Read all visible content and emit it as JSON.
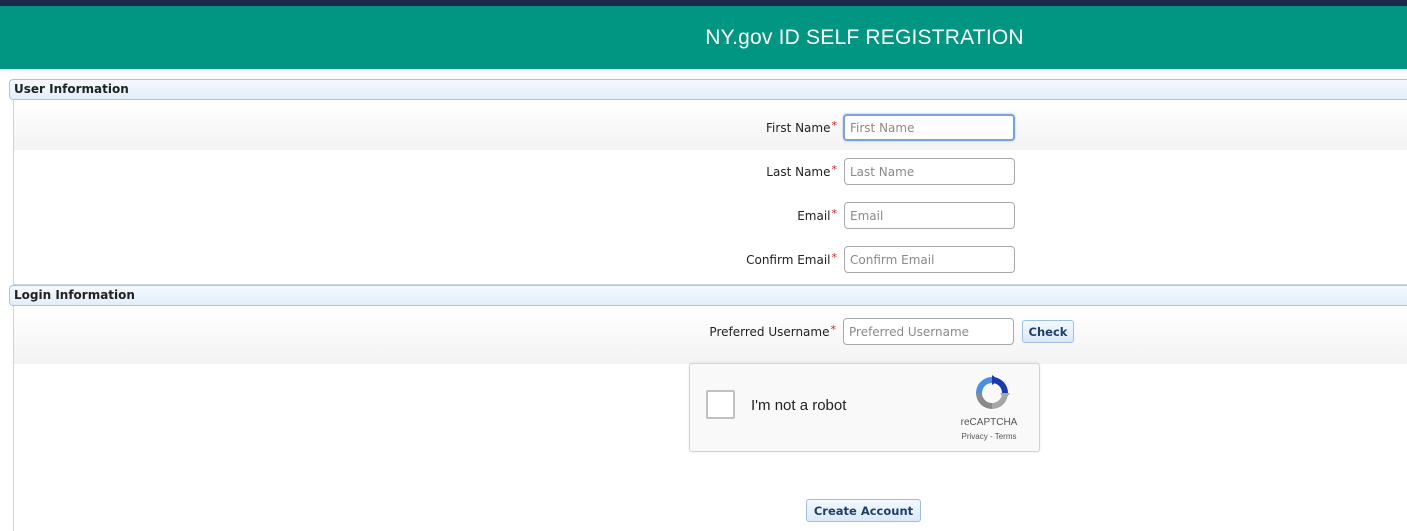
{
  "banner": {
    "title": "NY.gov ID SELF REGISTRATION"
  },
  "user_info": {
    "header": "User Information",
    "fields": [
      {
        "label": "First Name",
        "required_mark": "*",
        "placeholder": "First Name",
        "value": ""
      },
      {
        "label": "Last Name",
        "required_mark": "*",
        "placeholder": "Last Name",
        "value": ""
      },
      {
        "label": "Email",
        "required_mark": "*",
        "placeholder": "Email",
        "value": ""
      },
      {
        "label": "Confirm Email",
        "required_mark": "*",
        "placeholder": "Confirm Email",
        "value": ""
      }
    ]
  },
  "login_info": {
    "header": "Login Information",
    "username": {
      "label": "Preferred Username",
      "required_mark": "*",
      "placeholder": "Preferred Username",
      "value": ""
    },
    "check_button": "Check",
    "create_button": "Create Account"
  },
  "captcha": {
    "label": "I'm not a robot",
    "brand": "reCAPTCHA",
    "links": "Privacy - Terms",
    "checked": false
  },
  "colors": {
    "banner": "#009682",
    "topline": "#1b2a4a",
    "required": "#d0202a",
    "button_text": "#1f3f6b"
  },
  "icons": {
    "captcha": "recaptcha-logo-icon"
  }
}
